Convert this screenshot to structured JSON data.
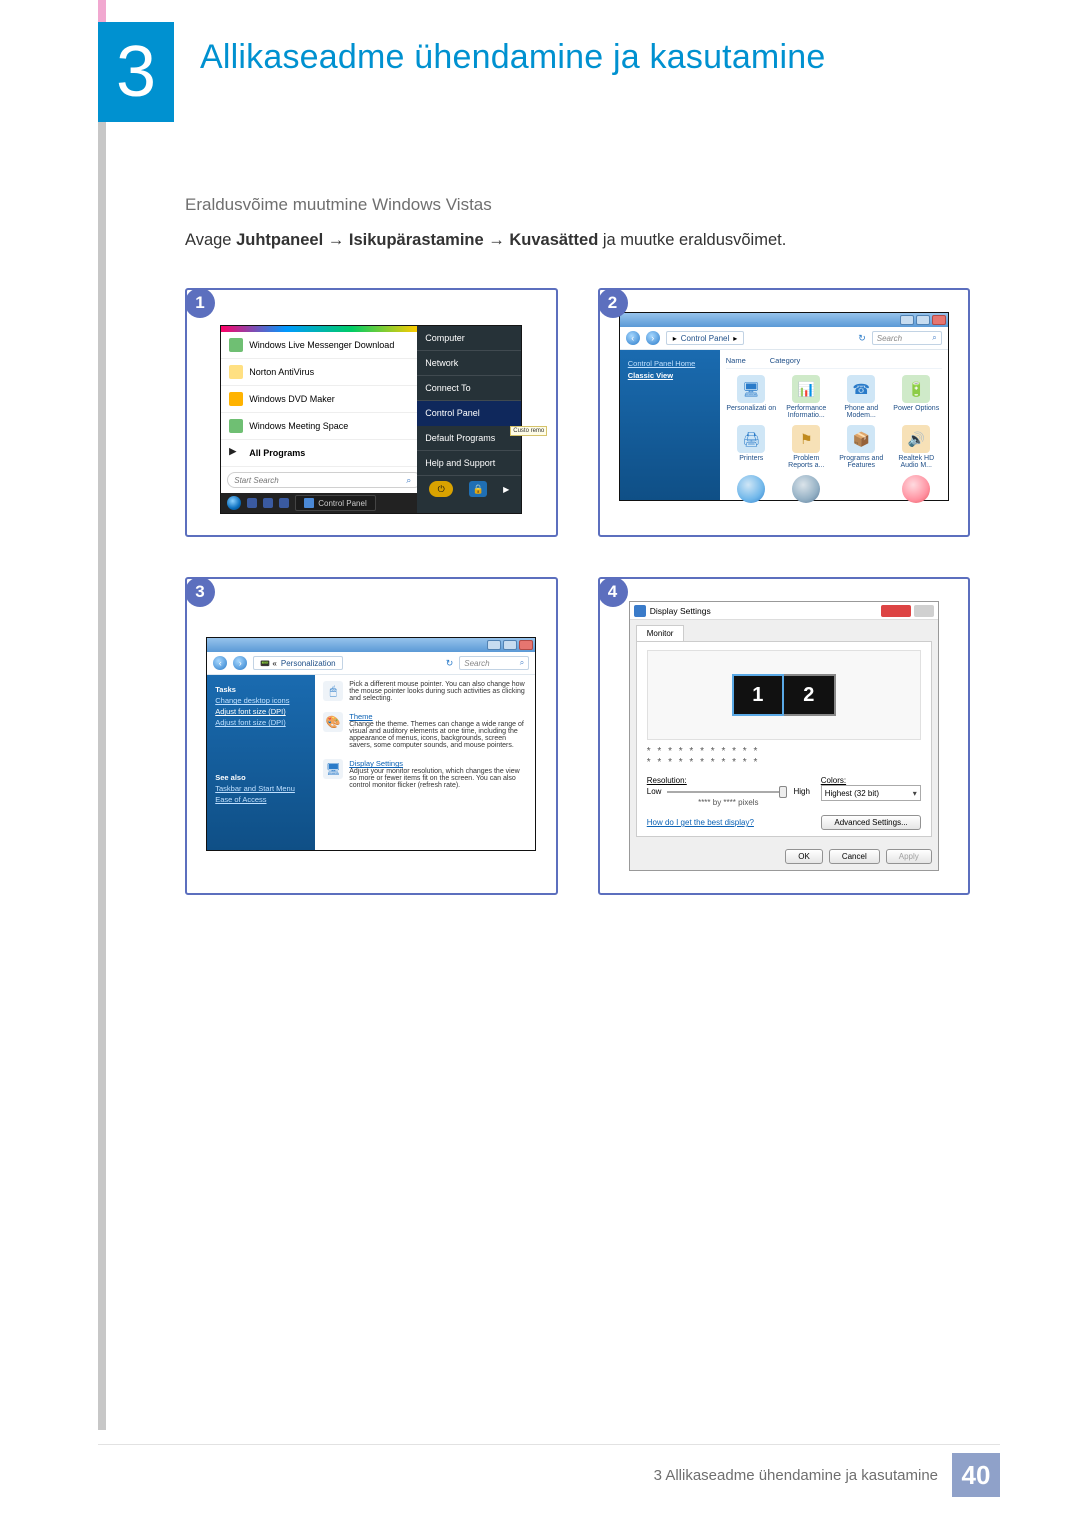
{
  "chapter": {
    "number": "3",
    "title": "Allikaseadme ühendamine ja kasutamine"
  },
  "section_label": "Eraldusvõime muutmine Windows Vistas",
  "instruction": {
    "prefix": "Avage ",
    "p1": "Juhtpaneel",
    "arrow": " → ",
    "p2": "Isikupärastamine",
    "p3": "Kuvasätted",
    "suffix": " ja muutke eraldusvõimet."
  },
  "steps": [
    "1",
    "2",
    "3",
    "4"
  ],
  "start_menu": {
    "items_left": [
      {
        "label": "Windows Live Messenger Download",
        "color": "g"
      },
      {
        "label": "Norton AntiVirus",
        "color": "ye"
      },
      {
        "label": "Windows DVD Maker",
        "color": "o"
      },
      {
        "label": "Windows Meeting Space",
        "color": "g"
      }
    ],
    "all_programs": "All Programs",
    "start_search": "Start Search",
    "taskbar_tile": "Control Panel",
    "items_right": [
      {
        "label": "Computer"
      },
      {
        "label": "Network"
      },
      {
        "label": "Connect To"
      },
      {
        "label": "Control Panel",
        "hi": true
      },
      {
        "label": "Default Programs"
      },
      {
        "label": "Help and Support"
      }
    ],
    "custo": "Custo remo"
  },
  "control_panel": {
    "crumb": "Control Panel",
    "search": "Search",
    "home": "Control Panel Home",
    "classic": "Classic View",
    "col1": "Name",
    "col2": "Category",
    "items": [
      "Personalizati on",
      "Performance Informatio...",
      "Phone and Modem...",
      "Power Options",
      "Printers",
      "Problem Reports a...",
      "Programs and Features",
      "Realtek HD Audio M..."
    ]
  },
  "personalization": {
    "crumb": "Personalization",
    "search": "Search",
    "tasks": "Tasks",
    "t1": "Change desktop icons",
    "t2": "Adjust font size (DPI)",
    "seealso": "See also",
    "s1": "Taskbar and Start Menu",
    "s2": "Ease of Access",
    "rows": [
      {
        "t": "",
        "d": "Pick a different mouse pointer. You can also change how the mouse pointer looks during such activities as clicking and selecting."
      },
      {
        "t": "Theme",
        "d": "Change the theme. Themes can change a wide range of visual and auditory elements at one time, including the appearance of menus, icons, backgrounds, screen savers, some computer sounds, and mouse pointers."
      },
      {
        "t": "Display Settings",
        "d": "Adjust your monitor resolution, which changes the view so more or fewer items fit on the screen. You can also control monitor flicker (refresh rate)."
      }
    ]
  },
  "display": {
    "title": "Display Settings",
    "tab": "Monitor",
    "mon1": "1",
    "mon2": "2",
    "stars": "* * * * * * * * * * *",
    "res": "Resolution:",
    "low": "Low",
    "high": "High",
    "byline": "**** by **** pixels",
    "colors": "Colors:",
    "colorsel": "Highest (32 bit)",
    "help": "How do I get the best display?",
    "adv": "Advanced Settings...",
    "ok": "OK",
    "cancel": "Cancel",
    "apply": "Apply"
  },
  "footer": {
    "line": "3 Allikaseadme ühendamine ja kasutamine",
    "page": "40"
  }
}
